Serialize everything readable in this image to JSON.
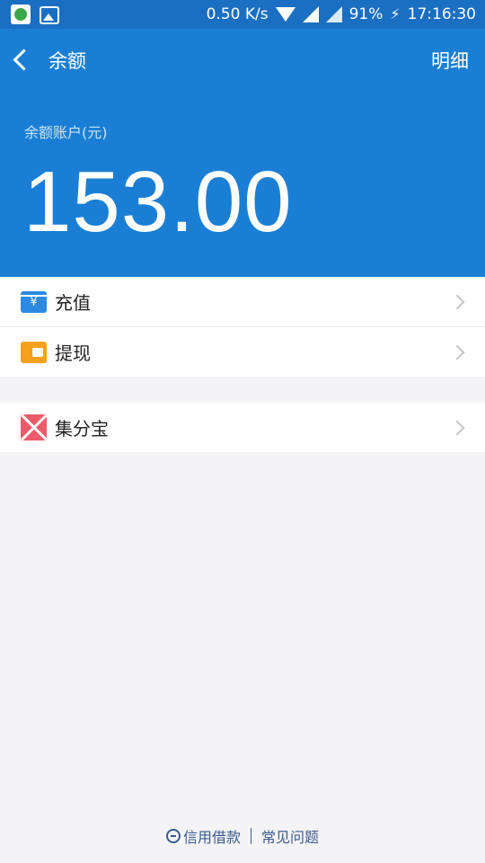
{
  "status_bar": {
    "speed": "0.50 K/s",
    "battery": "91%",
    "time": "17:16:30"
  },
  "header": {
    "title": "余额",
    "detail_label": "明细",
    "balance_label": "余额账户(元)",
    "balance_value": "153.00"
  },
  "menu": {
    "group1": [
      {
        "label": "充值",
        "icon": "recharge-icon",
        "symbol": "¥"
      },
      {
        "label": "提现",
        "icon": "withdraw-icon"
      }
    ],
    "group2": [
      {
        "label": "集分宝",
        "icon": "jifenbao-icon"
      }
    ]
  },
  "footer": {
    "credit_loan": "信用借款",
    "faq": "常见问题"
  },
  "colors": {
    "status_bar": "#1a6fc2",
    "header": "#1a7fd4",
    "recharge": "#2d8ae3",
    "withdraw": "#f3a21a",
    "jifenbao": "#ec5a6c",
    "footer_link": "#3a5b8c"
  }
}
